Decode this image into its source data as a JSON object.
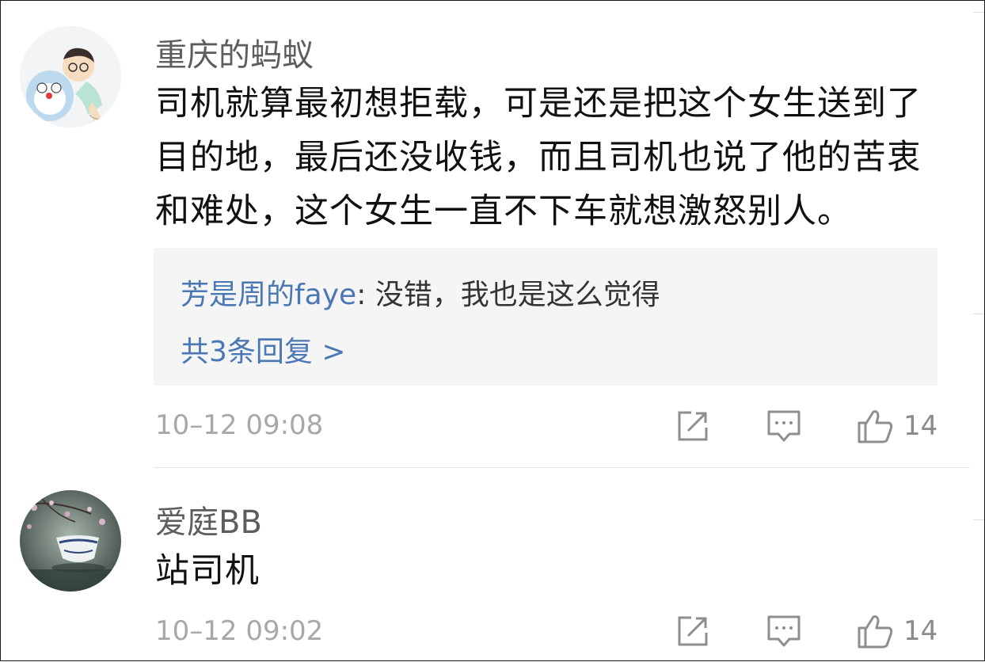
{
  "comments": [
    {
      "username": "重庆的蚂蚁",
      "content": "司机就算最初想拒载，可是还是把这个女生送到了目的地，最后还没收钱，而且司机也说了他的苦衷和难处，这个女生一直不下车就想激怒别人。",
      "reply_preview": {
        "user": "芳是周的faye",
        "separator": ": ",
        "text": "没错，我也是这么觉得"
      },
      "reply_count_label": "共3条回复 >",
      "timestamp": "10–12 09:08",
      "likes": "14",
      "avatar_icon": "cartoon-boy-avatar"
    },
    {
      "username": "爱庭BB",
      "content": "站司机",
      "timestamp": "10–12 09:02",
      "likes": "14",
      "avatar_icon": "teacup-flowers-avatar"
    }
  ],
  "icons": {
    "share": "share-icon",
    "comment": "comment-icon",
    "like": "like-icon"
  },
  "colors": {
    "link_blue": "#4a78b4",
    "text": "#111111",
    "muted": "#a8a8a8",
    "reply_bg": "#f5f5f5"
  }
}
